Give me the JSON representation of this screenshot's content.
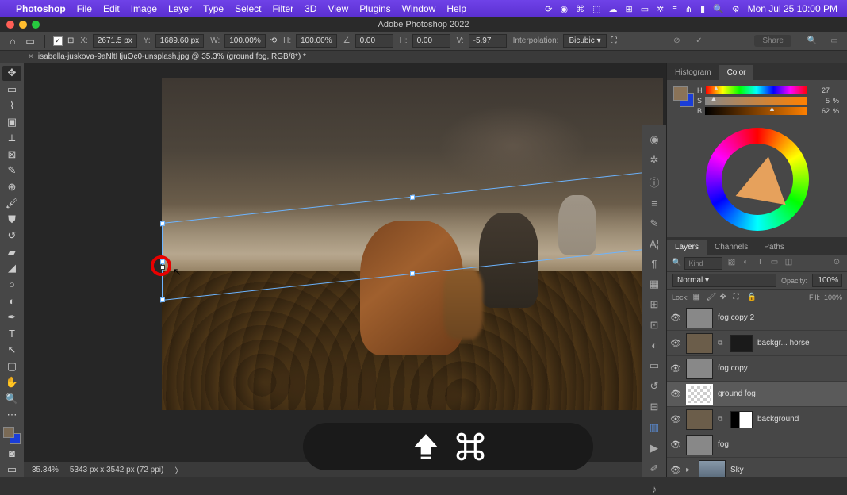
{
  "menubar": {
    "app": "Photoshop",
    "items": [
      "File",
      "Edit",
      "Image",
      "Layer",
      "Type",
      "Select",
      "Filter",
      "3D",
      "View",
      "Plugins",
      "Window",
      "Help"
    ],
    "datetime": "Mon Jul 25  10:00 PM"
  },
  "titlebar": {
    "title": "Adobe Photoshop 2022"
  },
  "options": {
    "x_label": "X:",
    "x": "2671.5 px",
    "y_label": "Y:",
    "y": "1689.60 px",
    "w_label": "W:",
    "w": "100.00%",
    "h_label": "H:",
    "h": "100.00%",
    "angle_label": "∠",
    "angle": "0.00",
    "hskew_label": "H:",
    "hskew": "0.00",
    "vskew_label": "V:",
    "vskew": "-5.97",
    "interp_label": "Interpolation:",
    "interp": "Bicubic",
    "share": "Share"
  },
  "tab": {
    "label": "isabella-juskova-9aNltHjuOc0-unsplash.jpg @ 35.3% (ground fog, RGB/8*) *"
  },
  "status": {
    "zoom": "35.34%",
    "dims": "5343 px x 3542 px (72 ppi)"
  },
  "color_panel": {
    "tabs": [
      "Histogram",
      "Color"
    ],
    "h_label": "H",
    "h_val": "27",
    "s_label": "S",
    "s_val": "5",
    "b_label": "B",
    "b_val": "62",
    "pct": "%"
  },
  "layers_panel": {
    "tabs": [
      "Layers",
      "Channels",
      "Paths"
    ],
    "kind_placeholder": "Kind",
    "blend": "Normal",
    "opacity_label": "Opacity:",
    "opacity": "100%",
    "lock_label": "Lock:",
    "fill_label": "Fill:",
    "fill": "100%",
    "layers": [
      {
        "name": "fog copy 2",
        "thumb": "grey"
      },
      {
        "name": "backgr... horse",
        "thumb": "img",
        "mask": "dark",
        "ext": true
      },
      {
        "name": "fog copy",
        "thumb": "grey"
      },
      {
        "name": "ground fog",
        "thumb": "checker",
        "sel": true
      },
      {
        "name": "background",
        "thumb": "img",
        "mask": "bw",
        "ext": true
      },
      {
        "name": "fog",
        "thumb": "grey"
      },
      {
        "name": "Sky",
        "thumb": "img",
        "arrow": true
      }
    ]
  },
  "keys": {
    "shift": "⇧",
    "cmd": "⌘"
  }
}
